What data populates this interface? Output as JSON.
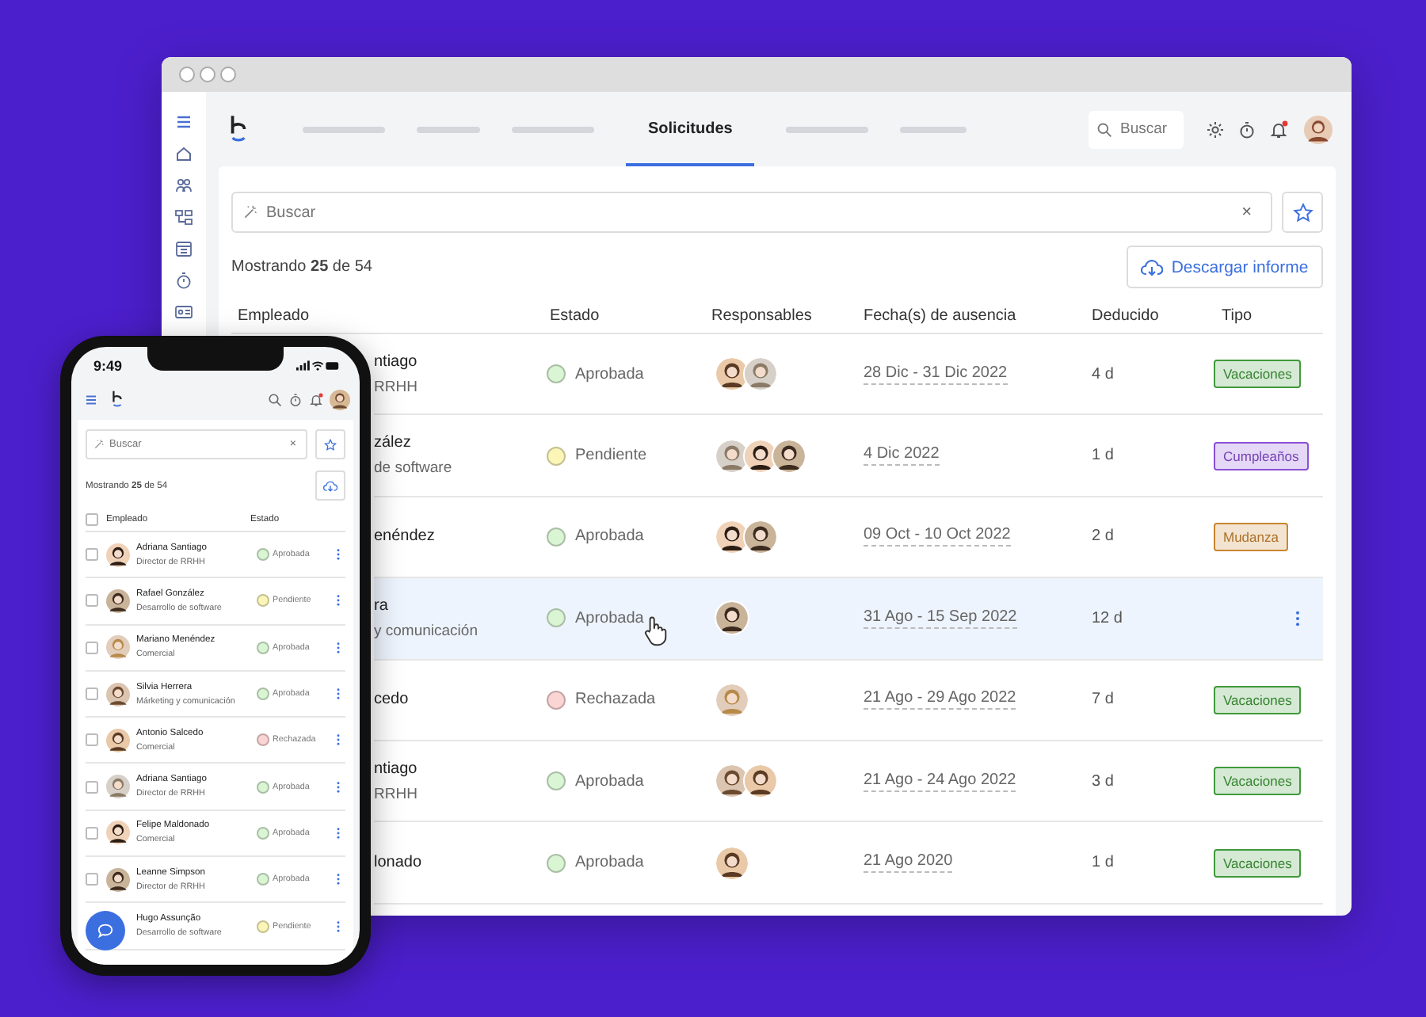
{
  "nav": {
    "tabs": [
      {
        "kind": "placeholder",
        "selected": false
      },
      {
        "kind": "placeholder",
        "selected": false
      },
      {
        "kind": "placeholder",
        "selected": false
      },
      {
        "kind": "label",
        "label": "Solicitudes",
        "selected": true
      },
      {
        "kind": "placeholder",
        "selected": false
      },
      {
        "kind": "placeholder",
        "selected": false
      }
    ],
    "search": {
      "placeholder": "Buscar"
    },
    "notifications": true
  },
  "filter": {
    "placeholder": "Buscar",
    "clear": "×"
  },
  "summary": "Mostrando **25** de 54",
  "download_button": "Descargar informe",
  "table": {
    "columns": [
      "Empleado",
      "Estado",
      "Responsables",
      "Fecha(s) de ausencia",
      "Deducido",
      "Tipo"
    ],
    "rows": [
      {
        "employee": "ntiago",
        "role": "RRHH",
        "status": {
          "label": "Aprobada",
          "color": "#d9f5d4"
        },
        "dates": "28 Dic - 31 Dic 2022",
        "deducted": "4 d",
        "type": {
          "label": "Vacaciones",
          "color": "#3f9a3a"
        },
        "selected": false
      },
      {
        "employee": "zález",
        "role": "de software",
        "status": {
          "label": "Pendiente",
          "color": "#fbf6b8"
        },
        "dates": "4 Dic 2022",
        "deducted": "1 d",
        "type": {
          "label": "Cumpleaños",
          "color": "#8a4fd6"
        },
        "selected": false
      },
      {
        "employee": "enéndez",
        "status": {
          "label": "Aprobada",
          "color": "#d9f5d4"
        },
        "dates": "09 Oct - 10 Oct 2022",
        "deducted": "2 d",
        "type": {
          "label": "Mudanza",
          "color": "#c98530"
        },
        "selected": false
      },
      {
        "employee": "ra",
        "role": "y comunicación",
        "status": {
          "label": "Aprobada",
          "color": "#d9f5d4"
        },
        "dates": "31 Ago - 15 Sep 2022",
        "deducted": "12 d",
        "selected": true
      },
      {
        "employee": "cedo",
        "status": {
          "label": "Rechazada",
          "color": "#fbd4d4"
        },
        "dates": "21 Ago - 29 Ago 2022",
        "deducted": "7 d",
        "type": {
          "label": "Vacaciones",
          "color": "#3f9a3a"
        },
        "selected": false
      },
      {
        "employee": "ntiago",
        "role": "RRHH",
        "status": {
          "label": "Aprobada",
          "color": "#d9f5d4"
        },
        "dates": "21 Ago - 24 Ago 2022",
        "deducted": "3 d",
        "type": {
          "label": "Vacaciones",
          "color": "#3f9a3a"
        },
        "selected": false
      },
      {
        "employee": "lonado",
        "status": {
          "label": "Aprobada",
          "color": "#d9f5d4"
        },
        "dates": "21 Ago 2020",
        "deducted": "1 d",
        "type": {
          "label": "Vacaciones",
          "color": "#3f9a3a"
        },
        "selected": false
      }
    ]
  },
  "mobile": {
    "time": "9:49",
    "notifications": true,
    "placeholder": "Buscar",
    "clear": "×",
    "summary": "Mostrando **25** de 54",
    "select_all": {
      "checked": false
    },
    "columns": [
      "Empleado",
      "Estado"
    ],
    "rows": [
      {
        "name": "Adriana Santiago",
        "role": "Director de RRHH",
        "status": {
          "label": "Aprobada",
          "color": "#d9f5d4"
        },
        "checked": false
      },
      {
        "name": "Rafael González",
        "role": "Desarrollo de software",
        "status": {
          "label": "Pendiente",
          "color": "#fbf6b8"
        },
        "checked": false
      },
      {
        "name": "Mariano Menéndez",
        "role": "Comercial",
        "status": {
          "label": "Aprobada",
          "color": "#d9f5d4"
        },
        "checked": false
      },
      {
        "name": "Silvia Herrera",
        "role": "Márketing y comunicación",
        "status": {
          "label": "Aprobada",
          "color": "#d9f5d4"
        },
        "checked": false
      },
      {
        "name": "Antonio Salcedo",
        "role": "Comercial",
        "status": {
          "label": "Rechazada",
          "color": "#fbd4d4"
        },
        "checked": false
      },
      {
        "name": "Adriana Santiago",
        "role": "Director de RRHH",
        "status": {
          "label": "Aprobada",
          "color": "#d9f5d4"
        },
        "checked": false
      },
      {
        "name": "Felipe Maldonado",
        "role": "Comercial",
        "status": {
          "label": "Aprobada",
          "color": "#d9f5d4"
        },
        "checked": false
      },
      {
        "name": "Leanne Simpson",
        "role": "Director de RRHH",
        "status": {
          "label": "Aprobada",
          "color": "#d9f5d4"
        },
        "checked": false
      },
      {
        "name": "Hugo Assunção",
        "role": "Desarrollo de software",
        "status": {
          "label": "Pendiente",
          "color": "#fbf6b8"
        }
      }
    ]
  }
}
